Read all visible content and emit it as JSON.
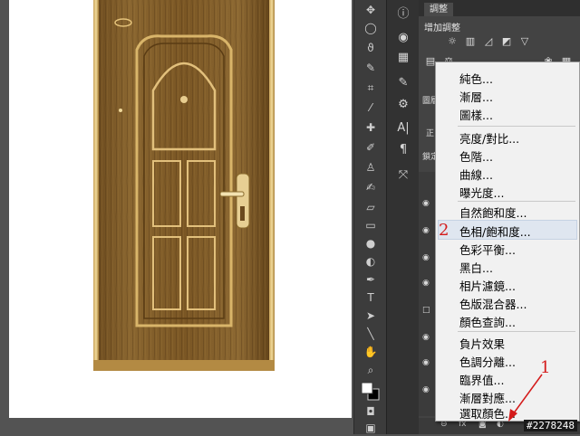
{
  "adjustments_panel": {
    "tab_label": "調整",
    "title": "增加調整"
  },
  "layer_labels": {
    "tab1": "圖層",
    "tab2": "正",
    "tab3": "鎖定"
  },
  "adjustment_menu": {
    "items": [
      "純色...",
      "漸層...",
      "圖樣...",
      "亮度/對比...",
      "色階...",
      "曲線...",
      "曝光度...",
      "自然飽和度...",
      "色相/飽和度...",
      "色彩平衡...",
      "黑白...",
      "相片濾鏡...",
      "色版混合器...",
      "顏色查詢...",
      "負片效果",
      "色調分離...",
      "臨界值...",
      "漸層對應...",
      "選取顏色..."
    ],
    "highlighted": "色相/飽和度..."
  },
  "annotations": {
    "marker_1": "1",
    "marker_2": "2"
  },
  "watermark": "#2278248",
  "colors": {
    "menu_highlight": "#dfe6f0",
    "annotation_red": "#d41a1a",
    "app_background": "#535353"
  },
  "icons": {
    "toolbar": [
      "move-icon",
      "marquee-icon",
      "lasso-icon",
      "quick-select-icon",
      "crop-icon",
      "eyedropper-icon",
      "healing-icon",
      "brush-icon",
      "stamp-icon",
      "history-brush-icon",
      "eraser-icon",
      "gradient-icon",
      "blur-icon",
      "dodge-icon",
      "pen-icon",
      "type-icon",
      "path-select-icon",
      "shape-icon",
      "hand-icon",
      "zoom-icon",
      "color-swatch-icon",
      "quick-mask-icon",
      "screen-mode-icon"
    ],
    "dock": [
      "info-icon",
      "color-icon",
      "swatches-icon",
      "brush-preset-icon",
      "tool-preset-icon",
      "character-icon",
      "paragraph-icon",
      "actions-icon"
    ]
  }
}
